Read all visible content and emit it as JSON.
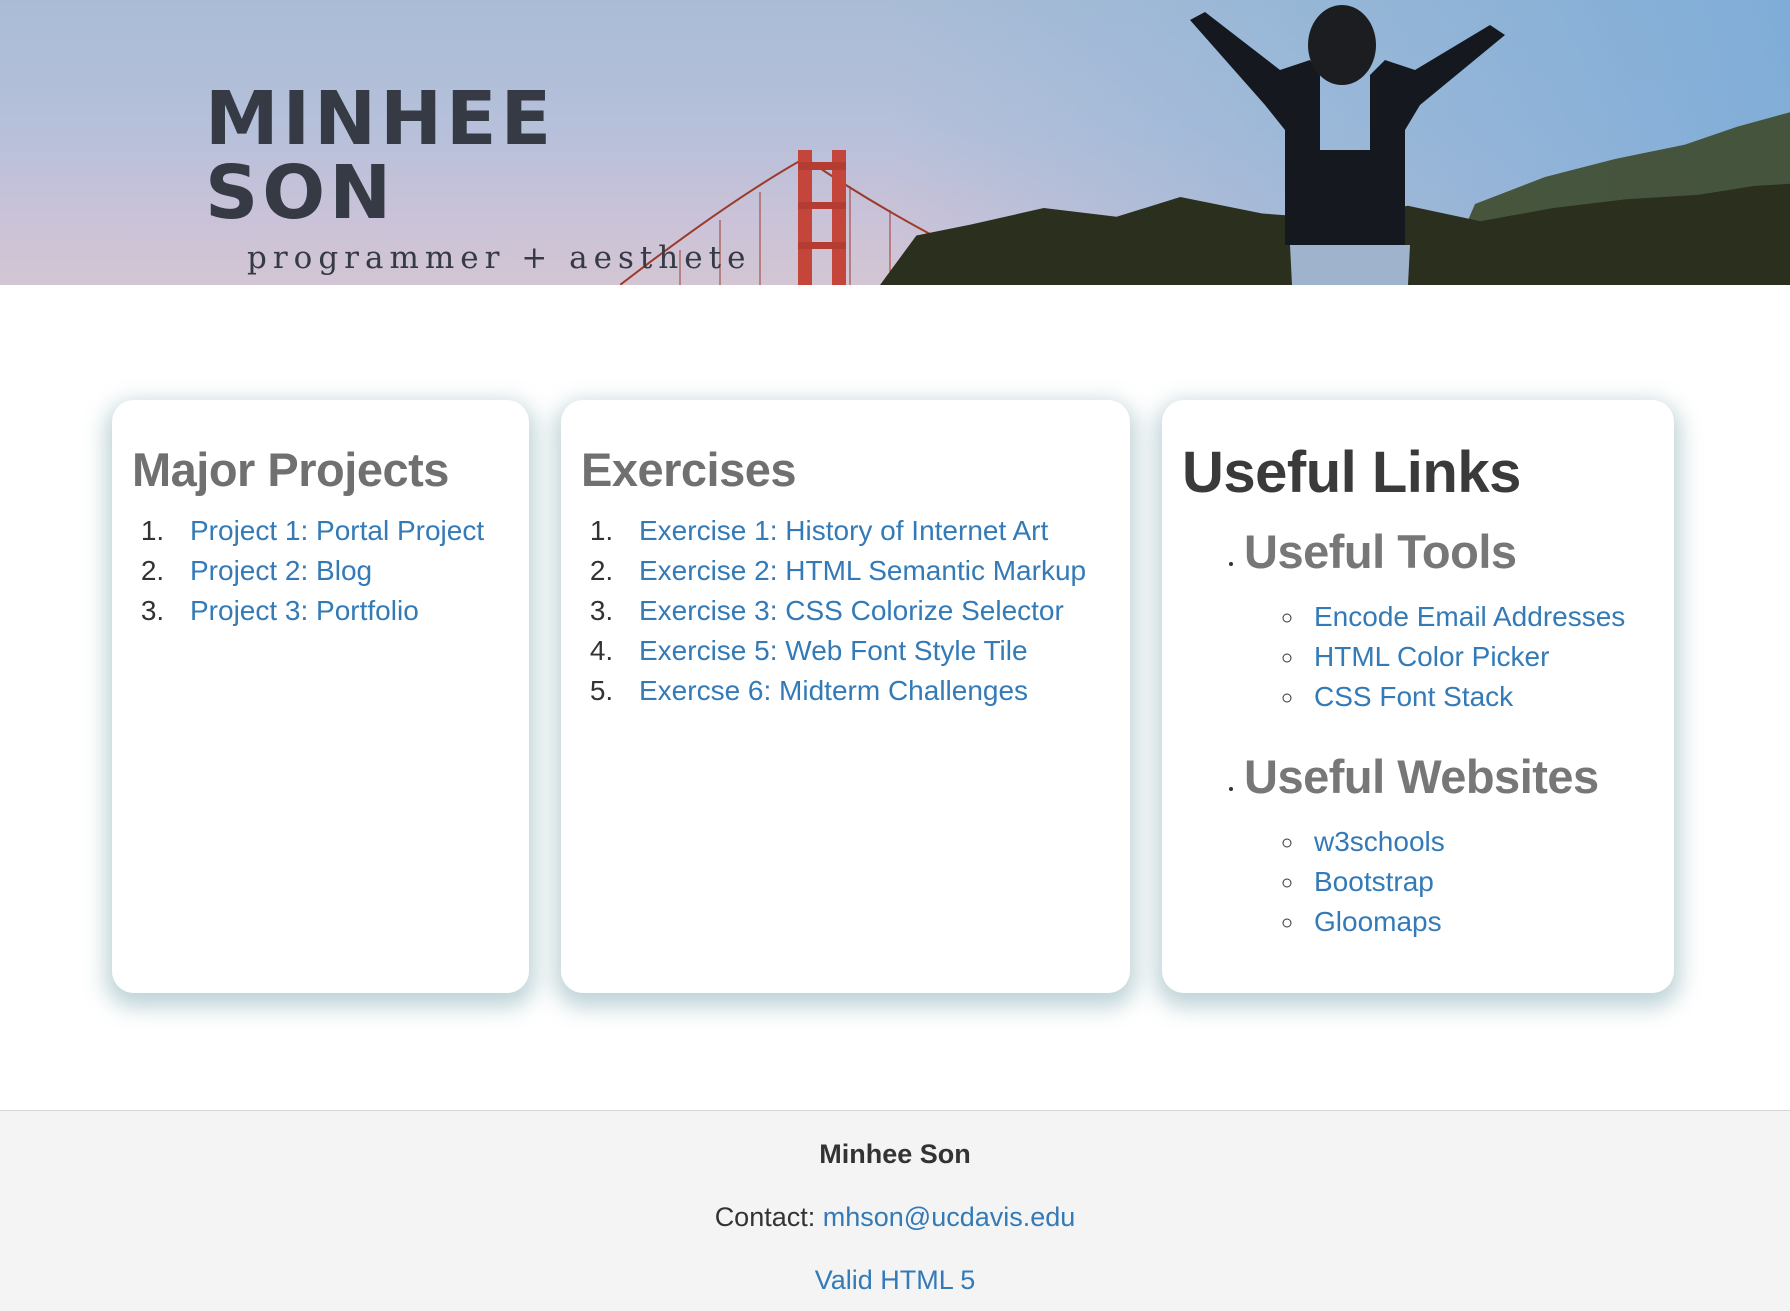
{
  "header": {
    "title": "MINHEE  SON",
    "subtitle": "programmer + aesthete"
  },
  "projects": {
    "heading": "Major Projects",
    "items": [
      {
        "number": "1.",
        "label": "Project 1: Portal Project"
      },
      {
        "number": "2.",
        "label": "Project 2: Blog"
      },
      {
        "number": "3.",
        "label": "Project 3: Portfolio"
      }
    ]
  },
  "exercises": {
    "heading": "Exercises",
    "items": [
      {
        "label": "Exercise 1: History of Internet Art"
      },
      {
        "label": "Exercise 2: HTML Semantic Markup"
      },
      {
        "label": "Exercise 3: CSS Colorize Selector"
      },
      {
        "label": "Exercise 5: Web Font Style Tile"
      },
      {
        "label": "Exercse 6: Midterm Challenges"
      }
    ]
  },
  "links": {
    "heading": "Useful Links",
    "tools": {
      "heading": "Useful Tools",
      "items": [
        "Encode Email Addresses",
        "HTML Color Picker",
        "CSS Font Stack"
      ]
    },
    "websites": {
      "heading": "Useful Websites",
      "items": [
        "w3schools",
        "Bootstrap",
        "Gloomaps"
      ]
    }
  },
  "footer": {
    "name": "Minhee Son",
    "contact_label": "Contact:",
    "email": "mhson@ucdavis.edu",
    "valid": "Valid HTML 5"
  },
  "colors": {
    "link": "#337ab7",
    "heading_gray": "#707070",
    "card_shadow": "#468c8c",
    "footer_bg": "#f4f4f4"
  }
}
